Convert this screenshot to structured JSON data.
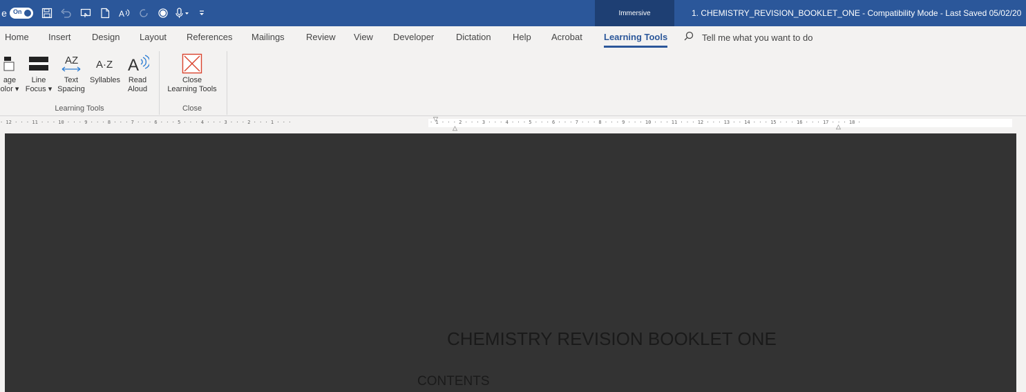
{
  "titlebar": {
    "autosave_label": "e",
    "autosave_state": "On",
    "immersive_tab": "Immersive",
    "document_title": "1. CHEMISTRY_REVISION_BOOKLET_ONE  -  Compatibility Mode  -  Last Saved 05/02/20",
    "qat_icons": [
      "save-icon",
      "undo-icon",
      "touch-mode-icon",
      "new-document-icon",
      "read-aloud-icon",
      "redo-icon",
      "record-icon",
      "dictate-icon",
      "customize-icon"
    ]
  },
  "tabs": [
    "Home",
    "Insert",
    "Design",
    "Layout",
    "References",
    "Mailings",
    "Review",
    "View",
    "Developer",
    "Dictation",
    "Help",
    "Acrobat",
    "Learning Tools"
  ],
  "active_tab": "Learning Tools",
  "tellme": {
    "placeholder": "Tell me what you want to do"
  },
  "ribbon": {
    "learning_tools_group": {
      "label": "Learning Tools",
      "buttons": {
        "page_color": {
          "line1": "age",
          "line2": "olor ▾"
        },
        "line_focus": {
          "line1": "Line",
          "line2": "Focus ▾"
        },
        "text_spacing": {
          "line1": "Text",
          "line2": "Spacing"
        },
        "syllables": {
          "line1": "Syllables",
          "line2": ""
        },
        "read_aloud": {
          "line1": "Read",
          "line2": "Aloud"
        }
      }
    },
    "close_group": {
      "label": "Close",
      "button": {
        "line1": "Close",
        "line2": "Learning Tools"
      }
    }
  },
  "ruler": {
    "left_numbers": "· 12 ·  ·  · 11 ·  ·  · 10 ·  ·  · 9 ·  ·  · 8 ·  ·  · 7 ·  ·  · 6 ·  ·  · 5 ·  ·  · 4 ·  ·  · 3 ·  ·  · 2 ·  ·  · 1 ·  ·  ·",
    "right_numbers": "  · 1 ·  ·  · 2 ·  ·  · 3 ·  ·  · 4 ·  ·  · 5 ·  ·  · 6 ·  ·  · 7 ·  ·  · 8 ·  ·  · 9 ·  ·  · 10 ·  ·  · 11 ·  ·  · 12 ·  ·  · 13 ·  · 14 ·  ·  · 15 ·  ·  · 16 ·  ·  · 17 ·  ·  · 18 ·"
  },
  "document": {
    "heading": "CHEMISTRY REVISION BOOKLET ONE",
    "contents": "CONTENTS",
    "background_color": "#333333"
  },
  "colors": {
    "accent": "#2b579a",
    "immersive": "#1e3f73",
    "close_icon": "#d9412b"
  }
}
